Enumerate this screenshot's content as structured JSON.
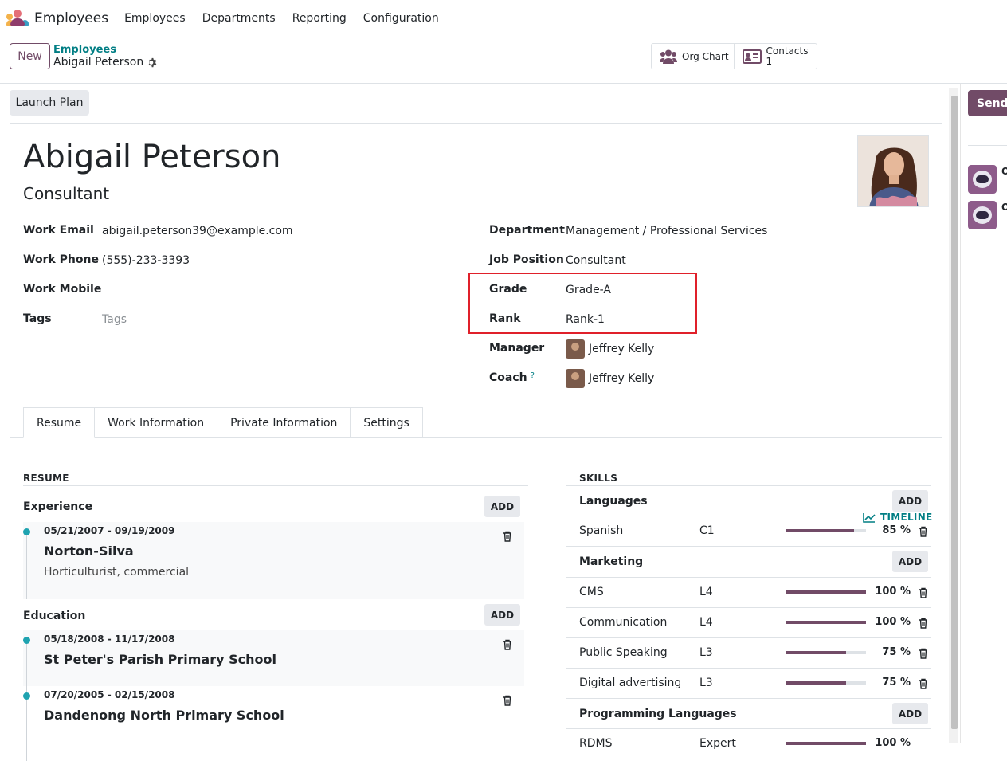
{
  "topnav": {
    "app_name": "Employees",
    "menu": [
      "Employees",
      "Departments",
      "Reporting",
      "Configuration"
    ]
  },
  "control_panel": {
    "new_label": "New",
    "breadcrumb_parent": "Employees",
    "breadcrumb_current": "Abigail Peterson",
    "smart_buttons": {
      "org_chart_label": "Org Chart",
      "contacts_label": "Contacts",
      "contacts_count": "1"
    }
  },
  "actions": {
    "launch_plan_label": "Launch Plan"
  },
  "employee": {
    "name": "Abigail Peterson",
    "job_title": "Consultant",
    "left_fields": {
      "work_email_label": "Work Email",
      "work_email": "abigail.peterson39@example.com",
      "work_phone_label": "Work Phone",
      "work_phone": "(555)-233-3393",
      "work_mobile_label": "Work Mobile",
      "work_mobile": "",
      "tags_label": "Tags",
      "tags_placeholder": "Tags"
    },
    "right_fields": {
      "department_label": "Department",
      "department": "Management / Professional Services",
      "job_position_label": "Job Position",
      "job_position": "Consultant",
      "grade_label": "Grade",
      "grade": "Grade-A",
      "rank_label": "Rank",
      "rank": "Rank-1",
      "manager_label": "Manager",
      "manager": "Jeffrey Kelly",
      "coach_label": "Coach",
      "coach_help": "?",
      "coach": "Jeffrey Kelly"
    }
  },
  "tabs": [
    "Resume",
    "Work Information",
    "Private Information",
    "Settings"
  ],
  "resume": {
    "title": "RESUME",
    "add_label": "ADD",
    "experience_label": "Experience",
    "education_label": "Education",
    "experience": [
      {
        "dates": "05/21/2007 - 09/19/2009",
        "title": "Norton-Silva",
        "description": "Horticulturist, commercial"
      }
    ],
    "education": [
      {
        "dates": "05/18/2008 - 11/17/2008",
        "title": "St Peter's Parish Primary School"
      },
      {
        "dates": "07/20/2005 - 02/15/2008",
        "title": "Dandenong North Primary School"
      }
    ]
  },
  "skills": {
    "title": "SKILLS",
    "timeline_label": "TIMELINE",
    "add_label": "ADD",
    "categories": {
      "languages": "Languages",
      "marketing": "Marketing",
      "programming": "Programming Languages"
    },
    "languages": [
      {
        "name": "Spanish",
        "level": "C1",
        "progress": 85,
        "pct_label": "85 %"
      }
    ],
    "marketing": [
      {
        "name": "CMS",
        "level": "L4",
        "progress": 100,
        "pct_label": "100 %"
      },
      {
        "name": "Communication",
        "level": "L4",
        "progress": 100,
        "pct_label": "100 %"
      },
      {
        "name": "Public Speaking",
        "level": "L3",
        "progress": 75,
        "pct_label": "75 %"
      },
      {
        "name": "Digital advertising",
        "level": "L3",
        "progress": 75,
        "pct_label": "75 %"
      }
    ],
    "programming": [
      {
        "name": "RDMS",
        "level": "Expert",
        "progress": 100,
        "pct_label": "100 %"
      }
    ]
  },
  "chatter": {
    "send_label": "Send message",
    "message_author_initial": "O"
  },
  "colors": {
    "brand": "#714b67",
    "link": "#017e84",
    "highlight": "#e0202a"
  }
}
